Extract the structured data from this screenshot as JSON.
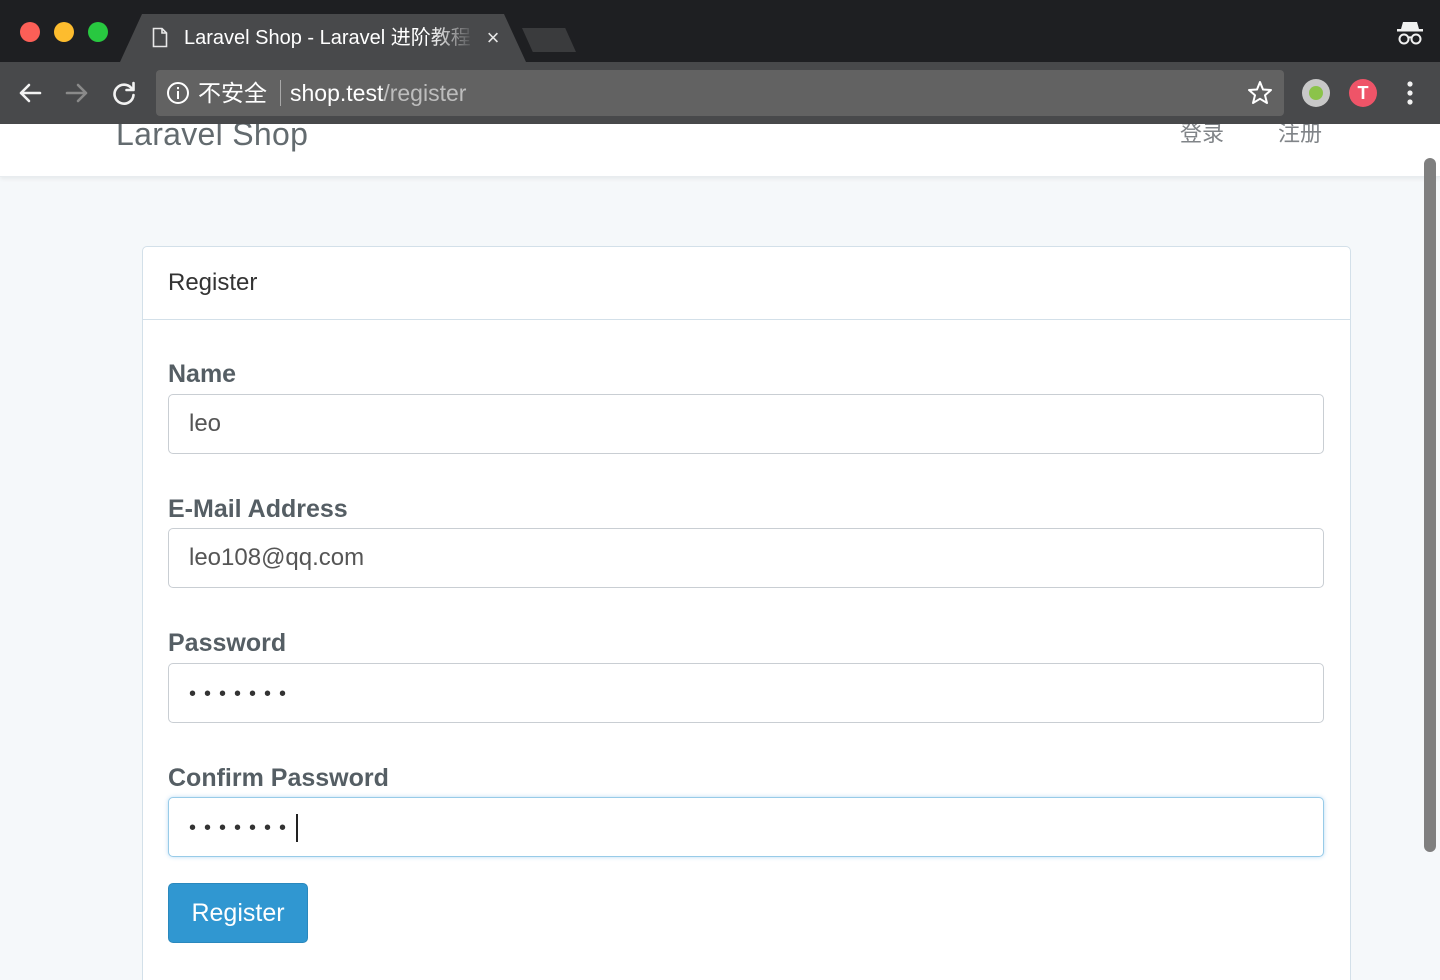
{
  "browser": {
    "tab_title": "Laravel Shop - Laravel 进阶教程",
    "tab_close": "×",
    "security_label": "不安全",
    "url_host": "shop.test",
    "url_path": "/register",
    "extension_badge": "T",
    "icons": [
      "document-icon",
      "incognito-icon",
      "back-arrow-icon",
      "forward-arrow-icon",
      "reload-icon",
      "info-icon",
      "bookmark-star-icon",
      "menu-dots-icon"
    ]
  },
  "navbar": {
    "brand": "Laravel Shop",
    "login_link": "登录",
    "register_link": "注册"
  },
  "form": {
    "heading": "Register",
    "fields": [
      {
        "label": "Name",
        "value": "leo"
      },
      {
        "label": "E-Mail Address",
        "value": "leo108@qq.com"
      },
      {
        "label": "Password",
        "value": "•••••••"
      },
      {
        "label": "Confirm Password",
        "value": "•••••••"
      }
    ],
    "submit_label": "Register"
  },
  "colors": {
    "accent": "#3097d1",
    "page_background": "#f5f8fa",
    "chrome_dark": "#1e1f22",
    "chrome_toolbar": "#48494b"
  }
}
